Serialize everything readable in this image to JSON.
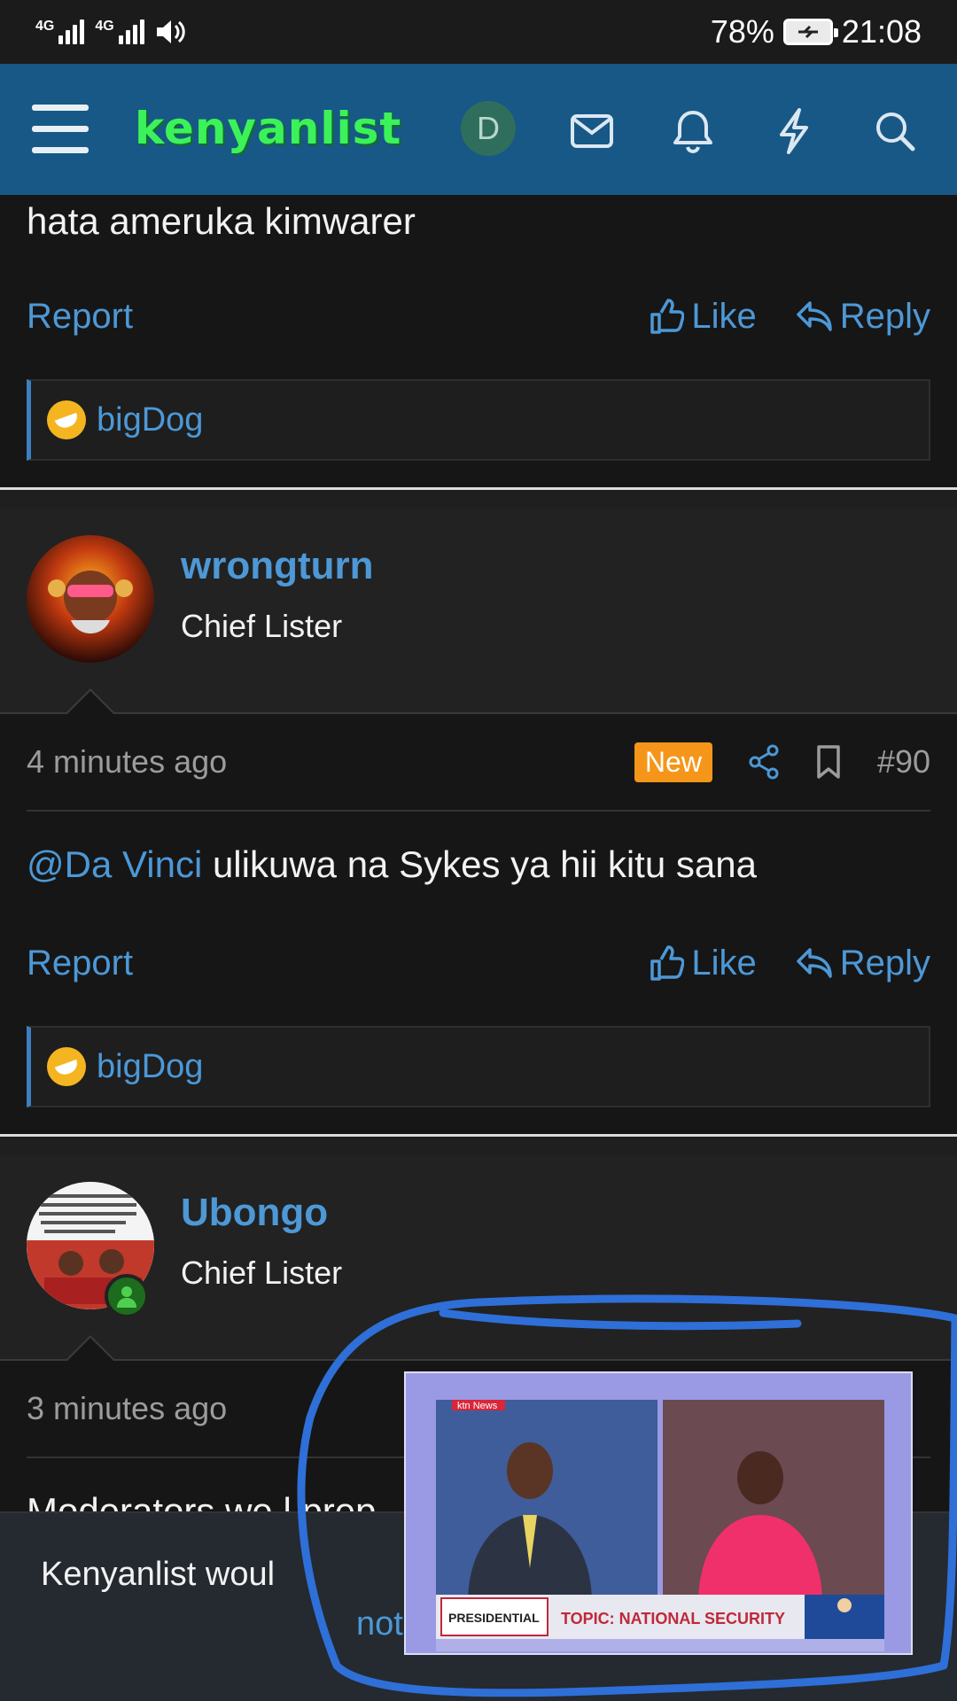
{
  "status_bar": {
    "network1": "4G",
    "network2": "4G",
    "battery_percent": "78%",
    "time": "21:08"
  },
  "header": {
    "logo_text": "kenyanlist",
    "avatar_letter": "D",
    "icons": [
      "menu-icon",
      "mail-icon",
      "bell-icon",
      "lightning-icon",
      "search-icon"
    ]
  },
  "colors": {
    "header_bg": "#185886",
    "link": "#4d98d6",
    "new_badge": "#f5961a",
    "logo": "#3cf25a"
  },
  "posts": [
    {
      "text": "hata ameruka kimwarer",
      "report_label": "Report",
      "like_label": "Like",
      "reply_label": "Reply",
      "reaction_user": "bigDog"
    },
    {
      "username": "wrongturn",
      "user_title": "Chief Lister",
      "time": "4 minutes ago",
      "badge": "New",
      "post_number": "#90",
      "mention": "@Da Vinci",
      "text": " ulikuwa na Sykes ya hii kitu sana",
      "report_label": "Report",
      "like_label": "Like",
      "reply_label": "Reply",
      "reaction_user": "bigDog"
    },
    {
      "username": "Ubongo",
      "user_title": "Chief Lister",
      "time": "3 minutes ago",
      "text": "Moderators we l prep"
    }
  ],
  "notification": {
    "text": "Kenyanlist woul",
    "link": "not"
  },
  "video": {
    "channel": "ktn News",
    "banner_left": "PRESIDENTIAL",
    "banner_topic": "TOPIC: NATIONAL SECURITY"
  }
}
